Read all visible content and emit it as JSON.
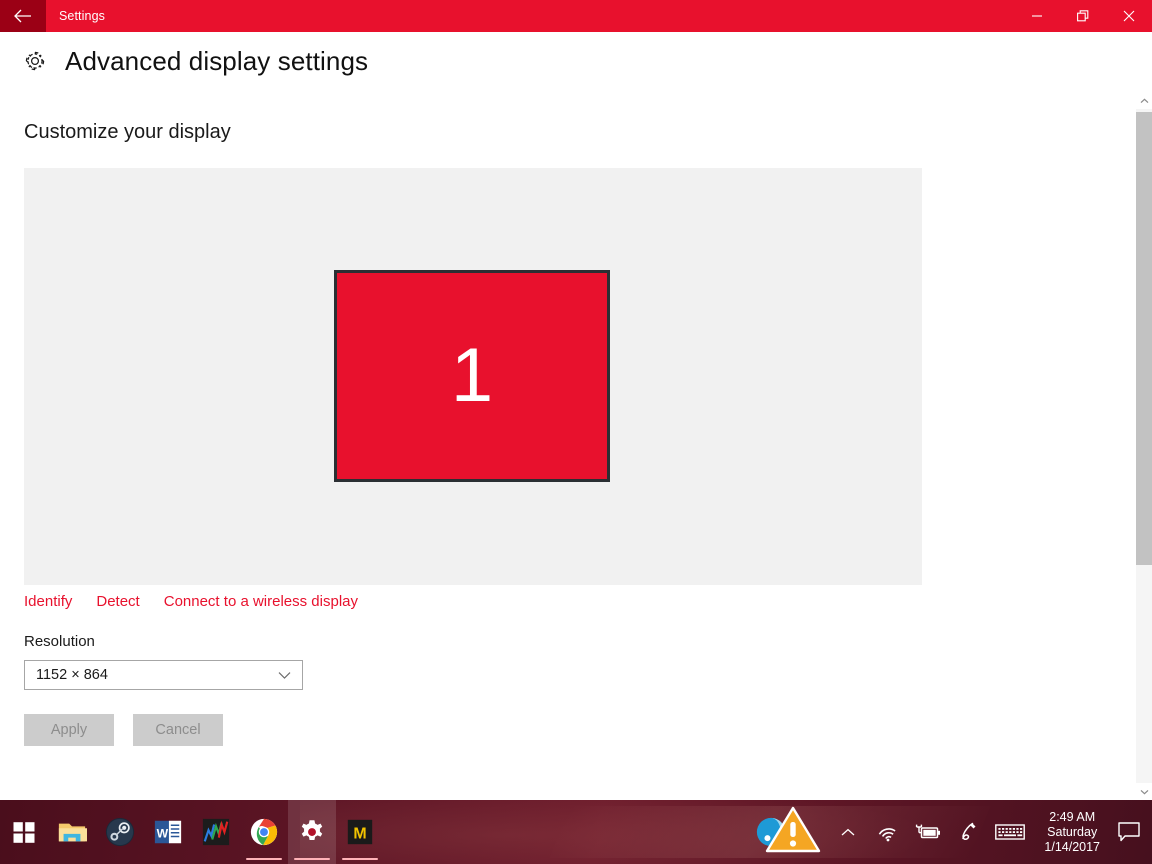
{
  "window": {
    "title": "Settings",
    "back_icon": "back-arrow-icon",
    "controls": {
      "minimize": "minimize-icon",
      "restore": "restore-icon",
      "close": "close-icon"
    },
    "accent_color": "#e8112d",
    "titlebar_color": "#e8112d",
    "back_button_color": "#9b0015"
  },
  "header": {
    "icon": "gear-icon",
    "title": "Advanced display settings"
  },
  "main": {
    "section_title": "Customize your display",
    "preview": {
      "panel_color": "#f1f1f1",
      "monitor_number": "1",
      "monitor_color": "#e8112d",
      "monitor_border_color": "#2b2f33"
    },
    "links": [
      {
        "label": "Identify",
        "name": "identify-link"
      },
      {
        "label": "Detect",
        "name": "detect-link"
      },
      {
        "label": "Connect to a wireless display",
        "name": "connect-wireless-display-link"
      }
    ],
    "resolution": {
      "label": "Resolution",
      "value": "1152 × 864",
      "chevron": "chevron-down-icon"
    },
    "buttons": {
      "apply": "Apply",
      "cancel": "Cancel",
      "disabled": true
    }
  },
  "scrollbar": {
    "up_arrow": "scroll-up-arrow-icon",
    "down_arrow": "scroll-down-arrow-icon"
  },
  "taskbar": {
    "start": "windows-start-icon",
    "items": [
      {
        "name": "taskbar-file-explorer",
        "icon": "file-explorer-icon",
        "active": false,
        "running": false
      },
      {
        "name": "taskbar-steam",
        "icon": "steam-icon",
        "active": false,
        "running": false
      },
      {
        "name": "taskbar-word",
        "icon": "word-icon",
        "active": false,
        "running": false
      },
      {
        "name": "taskbar-metatrader",
        "icon": "chart-tile-icon",
        "active": false,
        "running": false
      },
      {
        "name": "taskbar-chrome",
        "icon": "chrome-icon",
        "active": false,
        "running": true
      },
      {
        "name": "taskbar-settings",
        "icon": "gear-icon",
        "active": true,
        "running": true
      },
      {
        "name": "taskbar-mega",
        "icon": "mega-m-icon",
        "active": false,
        "running": true
      }
    ],
    "tray": {
      "warning": "warning-triangle-icon",
      "background_app": "blue-circle-app-icon",
      "show_hidden": "chevron-up-icon",
      "network": "wifi-icon",
      "battery": "battery-charging-icon",
      "pen": "pen-icon",
      "keyboard": "keyboard-icon",
      "action_center": "action-center-icon"
    },
    "clock": {
      "time": "2:49 AM",
      "day": "Saturday",
      "date": "1/14/2017"
    }
  }
}
